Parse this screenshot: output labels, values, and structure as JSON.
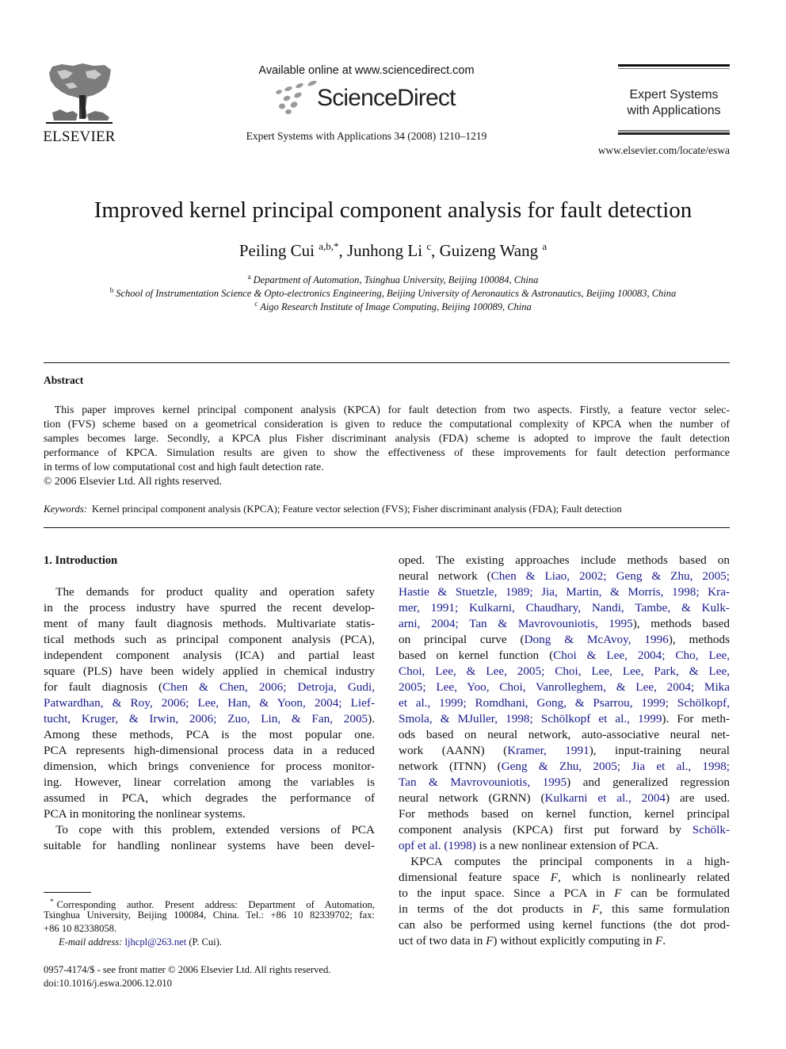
{
  "header": {
    "publisher_logo_text": "ELSEVIER",
    "sciencedirect_available": "Available online at www.sciencedirect.com",
    "sciencedirect_logo_text": "ScienceDirect",
    "journal_reference": "Expert Systems with Applications 34 (2008) 1210–1219",
    "journal_name_line1": "Expert Systems",
    "journal_name_line2": "with Applications",
    "journal_url": "www.elsevier.com/locate/eswa"
  },
  "article": {
    "title": "Improved kernel principal component analysis for fault detection",
    "authors": [
      {
        "name": "Peiling Cui",
        "sup": "a,b,*",
        "sep": ", "
      },
      {
        "name": "Junhong Li",
        "sup": "c",
        "sep": ", "
      },
      {
        "name": "Guizeng Wang",
        "sup": "a",
        "sep": ""
      }
    ],
    "affiliations": [
      {
        "mark": "a",
        "text": "Department of Automation, Tsinghua University, Beijing 100084, China"
      },
      {
        "mark": "b",
        "text": "School of Instrumentation Science & Opto-electronics Engineering, Beijing University of Aeronautics & Astronautics, Beijing 100083, China"
      },
      {
        "mark": "c",
        "text": "Aigo Research Institute of Image Computing, Beijing 100089, China"
      }
    ]
  },
  "abstract": {
    "heading": "Abstract",
    "lines": [
      " This paper improves kernel principal component analysis (KPCA) for fault detection from two aspects. Firstly, a feature vector selec-",
      "tion (FVS) scheme based on a geometrical consideration is given to reduce the computational complexity of KPCA when the number of",
      "samples becomes large. Secondly, a KPCA plus Fisher discriminant analysis (FDA) scheme is adopted to improve the fault detection",
      "performance of KPCA. Simulation results are given to show the effectiveness of these improvements for fault detection performance",
      "in terms of low computational cost and high fault detection rate."
    ],
    "copyright": "© 2006 Elsevier Ltd. All rights reserved.",
    "keywords_label": "Keywords:",
    "keywords": "Kernel principal component analysis (KPCA); Feature vector selection (FVS); Fisher discriminant analysis (FDA); Fault detection"
  },
  "introduction": {
    "heading": "1. Introduction",
    "left_column": [
      [
        {
          "t": " The demands for product quality and operation safety"
        }
      ],
      [
        {
          "t": "in the process industry have spurred the recent develop-"
        }
      ],
      [
        {
          "t": "ment of many fault diagnosis methods. Multivariate statis-"
        }
      ],
      [
        {
          "t": "tical methods such as principal component analysis (PCA),"
        }
      ],
      [
        {
          "t": "independent component analysis (ICA) and partial least"
        }
      ],
      [
        {
          "t": "square (PLS) have been widely applied in chemical industry"
        }
      ],
      [
        {
          "t": "for fault diagnosis ("
        },
        {
          "t": "Chen & Chen, 2006; Detroja, Gudi,",
          "c": 1
        }
      ],
      [
        {
          "t": "Patwardhan, & Roy, 2006; Lee, Han, & Yoon, 2004; Lief-",
          "c": 1
        }
      ],
      [
        {
          "t": "tucht, Kruger, & Irwin, 2006; Zuo, Lin, & Fan, 2005",
          "c": 1
        },
        {
          "t": ")."
        }
      ],
      [
        {
          "t": "Among these methods, PCA is the most popular one."
        }
      ],
      [
        {
          "t": "PCA represents high-dimensional process data in a reduced"
        }
      ],
      [
        {
          "t": "dimension, which brings convenience for process monitor-"
        }
      ],
      [
        {
          "t": "ing. However, linear correlation among the variables is"
        }
      ],
      [
        {
          "t": "assumed in PCA, which degrades the performance of"
        }
      ],
      [
        {
          "t": "PCA in monitoring the nonlinear systems.",
          "last": 1
        }
      ],
      [
        {
          "t": " To cope with this problem, extended versions of PCA"
        }
      ],
      [
        {
          "t": "suitable for handling nonlinear systems have been devel-"
        }
      ]
    ],
    "right_column": [
      [
        {
          "t": "oped. The existing approaches include methods based on"
        }
      ],
      [
        {
          "t": "neural network ("
        },
        {
          "t": "Chen & Liao, 2002; Geng & Zhu, 2005;",
          "c": 1
        }
      ],
      [
        {
          "t": "Hastie & Stuetzle, 1989; Jia, Martin, & Morris, 1998; Kra-",
          "c": 1
        }
      ],
      [
        {
          "t": "mer, 1991; Kulkarni, Chaudhary, Nandi, Tambe, & Kulk-",
          "c": 1
        }
      ],
      [
        {
          "t": "arni, 2004; Tan & Mavrovouniotis, 1995",
          "c": 1
        },
        {
          "t": "), methods based"
        }
      ],
      [
        {
          "t": "on principal curve ("
        },
        {
          "t": "Dong & McAvoy, 1996",
          "c": 1
        },
        {
          "t": "), methods"
        }
      ],
      [
        {
          "t": "based on kernel function ("
        },
        {
          "t": "Choi & Lee, 2004; Cho, Lee,",
          "c": 1
        }
      ],
      [
        {
          "t": "Choi, Lee, & Lee, 2005; Choi, Lee, Lee, Park, & Lee,",
          "c": 1
        }
      ],
      [
        {
          "t": "2005; Lee, Yoo, Choi, Vanrolleghem, & Lee, 2004; Mika",
          "c": 1
        }
      ],
      [
        {
          "t": "et al., 1999; Romdhani, Gong, & Psarrou, 1999; Schölkopf,",
          "c": 1
        }
      ],
      [
        {
          "t": "Smola, & MJuller, 1998; Schölkopf et al., 1999",
          "c": 1
        },
        {
          "t": "). For meth-"
        }
      ],
      [
        {
          "t": "ods based on neural network, auto-associative neural net-"
        }
      ],
      [
        {
          "t": "work (AANN) ("
        },
        {
          "t": "Kramer, 1991",
          "c": 1
        },
        {
          "t": "), input-training neural"
        }
      ],
      [
        {
          "t": "network (ITNN) ("
        },
        {
          "t": "Geng & Zhu, 2005; Jia et al., 1998;",
          "c": 1
        }
      ],
      [
        {
          "t": "Tan & Mavrovouniotis, 1995",
          "c": 1
        },
        {
          "t": ") and generalized regression"
        }
      ],
      [
        {
          "t": "neural network (GRNN) ("
        },
        {
          "t": "Kulkarni et al., 2004",
          "c": 1
        },
        {
          "t": ") are used."
        }
      ],
      [
        {
          "t": "For methods based on kernel function, kernel principal"
        }
      ],
      [
        {
          "t": "component analysis (KPCA) first put forward by "
        },
        {
          "t": "Schölk-",
          "c": 1
        }
      ],
      [
        {
          "t": "opf et al. (1998)",
          "c": 1
        },
        {
          "t": " is a new nonlinear extension of PCA.",
          "last": 1
        }
      ],
      [
        {
          "t": " KPCA computes the principal components in a high-"
        }
      ],
      [
        {
          "t": "dimensional feature space "
        },
        {
          "t": "F",
          "i": 1
        },
        {
          "t": ", which is nonlinearly related"
        }
      ],
      [
        {
          "t": "to the input space. Since a PCA in "
        },
        {
          "t": "F",
          "i": 1
        },
        {
          "t": " can be formulated"
        }
      ],
      [
        {
          "t": "in terms of the dot products in "
        },
        {
          "t": "F",
          "i": 1
        },
        {
          "t": ", this same formulation"
        }
      ],
      [
        {
          "t": "can also be performed using kernel functions (the dot prod-"
        }
      ],
      [
        {
          "t": "uct of two data in "
        },
        {
          "t": "F",
          "i": 1
        },
        {
          "t": ") without explicitly computing in "
        },
        {
          "t": "F",
          "i": 1
        },
        {
          "t": ".",
          "last": 1
        }
      ]
    ]
  },
  "footnote": {
    "mark": "*",
    "lines": [
      "Corresponding author. Present address: Department of Automation,",
      "Tsinghua University, Beijing 100084, China. Tel.: +86 10 82339702; fax:",
      "+86 10 82338058."
    ],
    "email_label": "E-mail address:",
    "email": "ljhcpl@263.net",
    "email_suffix": " (P. Cui)."
  },
  "front_matter": {
    "issn_line": "0957-4174/$ - see front matter © 2006 Elsevier Ltd. All rights reserved.",
    "doi": "doi:10.1016/j.eswa.2006.12.010"
  },
  "colors": {
    "citation_link": "#1a1a8c",
    "text": "#111111"
  }
}
